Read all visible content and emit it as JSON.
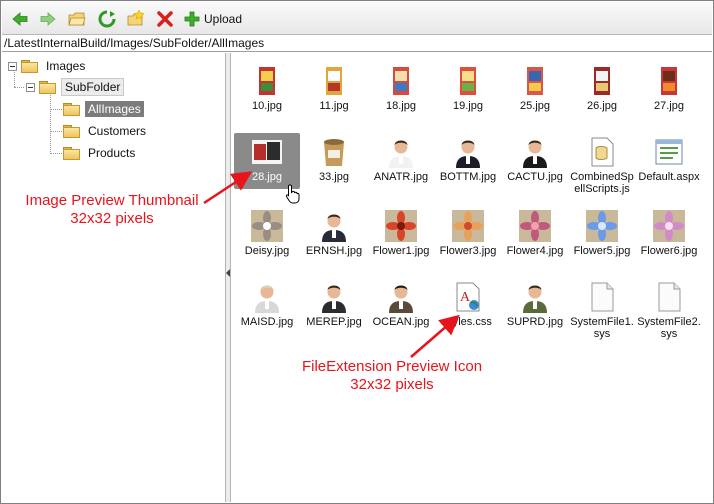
{
  "toolbar": {
    "upload_label": "Upload",
    "buttons": [
      "back-icon",
      "forward-icon",
      "open-folder-icon",
      "refresh-icon",
      "new-folder-icon",
      "delete-icon",
      "upload-icon"
    ]
  },
  "path": "/LatestInternalBuild/Images/SubFolder/AllImages",
  "tree": {
    "root": "Images",
    "child": "SubFolder",
    "leaves": [
      "AllImages",
      "Customers",
      "Products"
    ],
    "selected": "AllImages"
  },
  "files": [
    {
      "name": "10.jpg"
    },
    {
      "name": "11.jpg"
    },
    {
      "name": "18.jpg"
    },
    {
      "name": "19.jpg"
    },
    {
      "name": "25.jpg"
    },
    {
      "name": "26.jpg"
    },
    {
      "name": "27.jpg"
    },
    {
      "name": "28.jpg",
      "selected": true
    },
    {
      "name": "33.jpg"
    },
    {
      "name": "ANATR.jpg"
    },
    {
      "name": "BOTTM.jpg"
    },
    {
      "name": "CACTU.jpg"
    },
    {
      "name": "CombinedSpellScripts.js"
    },
    {
      "name": "Default.aspx"
    },
    {
      "name": "Deisy.jpg"
    },
    {
      "name": "ERNSH.jpg"
    },
    {
      "name": "Flower1.jpg"
    },
    {
      "name": "Flower3.jpg"
    },
    {
      "name": "Flower4.jpg"
    },
    {
      "name": "Flower5.jpg"
    },
    {
      "name": "Flower6.jpg"
    },
    {
      "name": "MAISD.jpg"
    },
    {
      "name": "MEREP.jpg"
    },
    {
      "name": "OCEAN.jpg"
    },
    {
      "name": "styles.css"
    },
    {
      "name": "SUPRD.jpg"
    },
    {
      "name": "SystemFile1.sys"
    },
    {
      "name": "SystemFile2.sys"
    }
  ],
  "annotations": {
    "thumbnail": "Image Preview Thumbnail\n32x32 pixels",
    "extension_icon": "FileExtension Preview Icon\n32x32 pixels"
  },
  "colors": {
    "annotation": "#e8141b",
    "selection": "#7c7c7c"
  }
}
